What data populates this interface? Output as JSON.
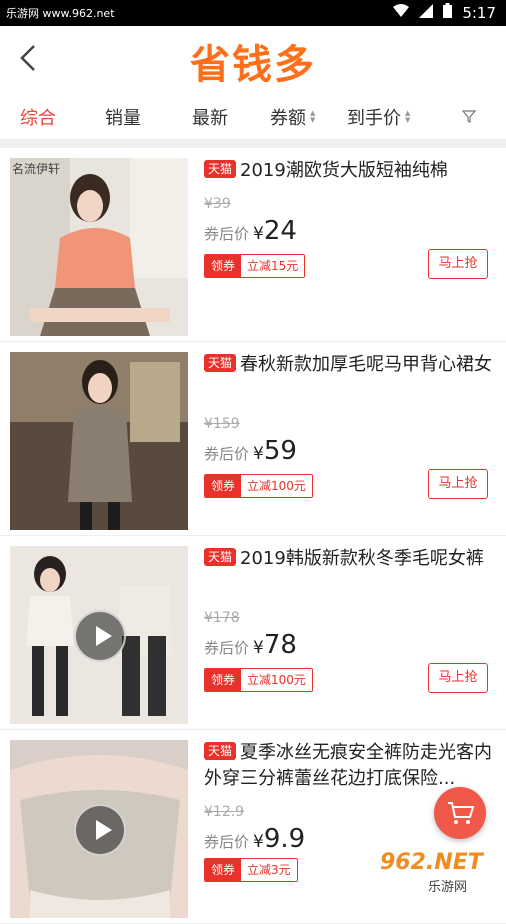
{
  "statusbar": {
    "source": "乐游网 www.962.net",
    "time": "5:17"
  },
  "header": {
    "logo_text": "省钱多"
  },
  "filters": [
    {
      "label": "综合"
    },
    {
      "label": "销量"
    },
    {
      "label": "最新"
    },
    {
      "label": "券额"
    },
    {
      "label": "到手价"
    }
  ],
  "labels": {
    "tmall": "天猫",
    "after_coupon": "券后价",
    "yen": "¥",
    "coupon": "领券",
    "buy": "马上抢"
  },
  "products": [
    {
      "title": "2019潮欧货大版短袖纯棉",
      "old_price": "¥39",
      "price": "24",
      "discount": "立减15元",
      "brand": "名流伊轩"
    },
    {
      "title": "春秋新款加厚毛呢马甲背心裙女",
      "old_price": "¥159",
      "price": "59",
      "discount": "立减100元"
    },
    {
      "title": "2019韩版新款秋冬季毛呢女裤",
      "old_price": "¥178",
      "price": "78",
      "discount": "立减100元"
    },
    {
      "title": "夏季冰丝无痕安全裤防走光客内外穿三分裤蕾丝花边打底保险...",
      "old_price": "¥12.9",
      "price": "9.9",
      "discount": "立减3元"
    }
  ],
  "watermark": {
    "brand": "962.NET",
    "sub": "乐游网"
  },
  "colors": {
    "accent": "#e8312a",
    "logo": "#ff6f1a"
  }
}
